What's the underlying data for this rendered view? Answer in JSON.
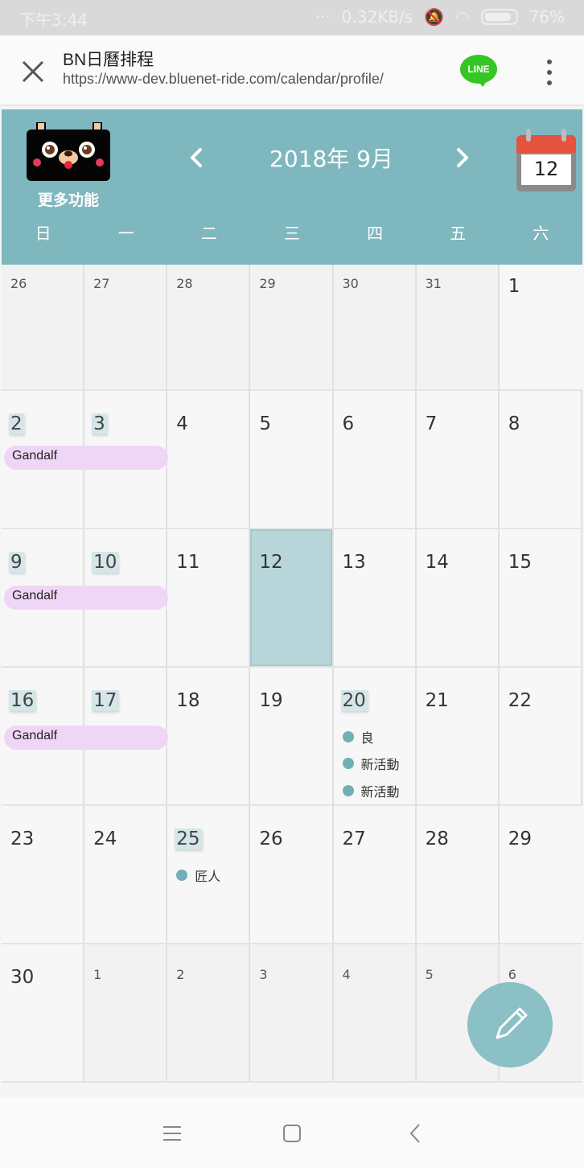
{
  "status_bar": {
    "time": "下午3:44",
    "net_speed": "0.32KB/s",
    "battery": "76%"
  },
  "browser": {
    "title": "BN日曆排程",
    "url": "https://www-dev.bluenet-ride.com/calendar/profile/",
    "line_label": "LINE"
  },
  "calendar": {
    "menu_label": "更多功能",
    "month_title": "2018年 9月",
    "today_day": "12",
    "weekdays": [
      "日",
      "一",
      "二",
      "三",
      "四",
      "五",
      "六"
    ],
    "weeks": [
      [
        "26",
        "27",
        "28",
        "29",
        "30",
        "31",
        "1"
      ],
      [
        "2",
        "3",
        "4",
        "5",
        "6",
        "7",
        "8"
      ],
      [
        "9",
        "10",
        "11",
        "12",
        "13",
        "14",
        "15"
      ],
      [
        "16",
        "17",
        "18",
        "19",
        "20",
        "21",
        "22"
      ],
      [
        "23",
        "24",
        "25",
        "26",
        "27",
        "28",
        "29"
      ],
      [
        "30",
        "1",
        "2",
        "3",
        "4",
        "5",
        "6"
      ]
    ],
    "span_events": [
      "Gandalf",
      "Gandalf",
      "Gandalf"
    ],
    "day_events": {
      "sep20": [
        "良",
        "新活動",
        "新活動"
      ],
      "sep25": [
        "匠人"
      ]
    }
  },
  "colors": {
    "header": "#7fb7bf",
    "today": "#b8d6da",
    "event_bar": "#f0d6f6",
    "event_dot": "#6fb0b6"
  }
}
